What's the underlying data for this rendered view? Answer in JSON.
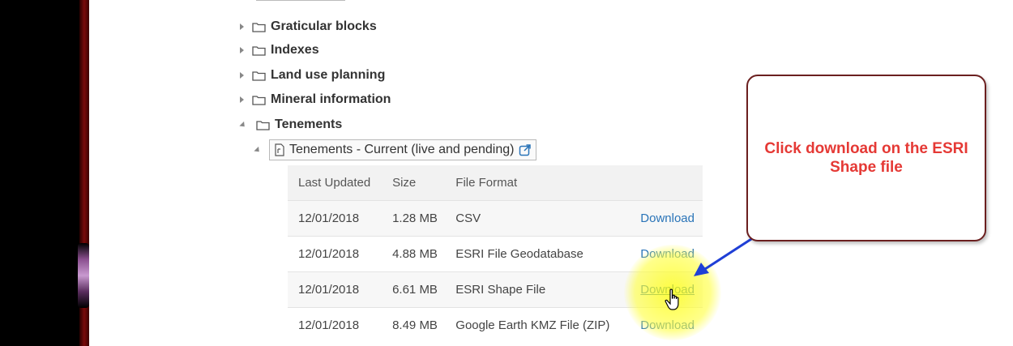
{
  "tree": {
    "items": [
      {
        "label": "Graticular blocks",
        "expanded": false
      },
      {
        "label": "Indexes",
        "expanded": false
      },
      {
        "label": "Land use planning",
        "expanded": false
      },
      {
        "label": "Mineral information",
        "expanded": false
      },
      {
        "label": "Tenements",
        "expanded": true
      }
    ],
    "dataset": {
      "label": "Tenements - Current (live and pending)"
    }
  },
  "table": {
    "headers": {
      "updated": "Last Updated",
      "size": "Size",
      "format": "File Format"
    },
    "rows": [
      {
        "updated": "12/01/2018",
        "size": "1.28 MB",
        "format": "CSV",
        "action": "Download"
      },
      {
        "updated": "12/01/2018",
        "size": "4.88 MB",
        "format": "ESRI File Geodatabase",
        "action": "Download"
      },
      {
        "updated": "12/01/2018",
        "size": "6.61 MB",
        "format": "ESRI Shape File",
        "action": "Download"
      },
      {
        "updated": "12/01/2018",
        "size": "8.49 MB",
        "format": "Google Earth KMZ File (ZIP)",
        "action": "Download"
      }
    ]
  },
  "callout": {
    "text": "Click download on the ESRI Shape file"
  },
  "colors": {
    "callout_text": "#e53935",
    "callout_border": "#6b1f1f",
    "link": "#2a74b8",
    "arrow": "#1f3fd6",
    "highlight": "#ffff00"
  },
  "icons": [
    "folder-icon",
    "caret-right-icon",
    "caret-down-icon",
    "document-icon",
    "external-link-icon",
    "hand-cursor-icon",
    "arrow-icon"
  ]
}
